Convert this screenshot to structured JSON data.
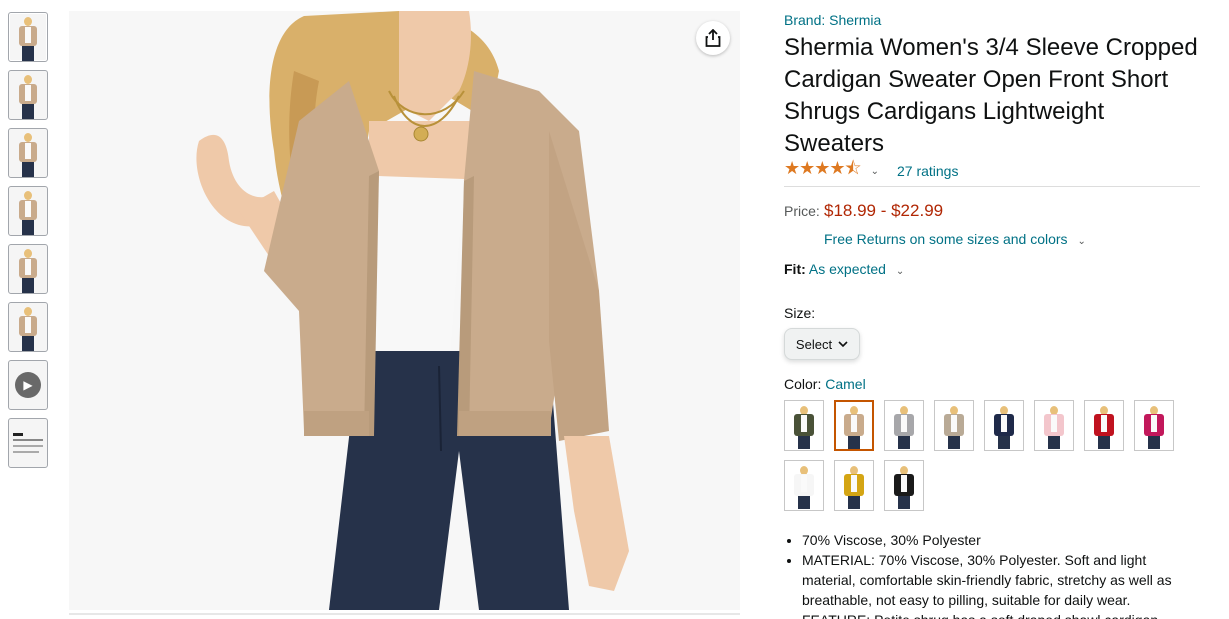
{
  "thumbnails": [
    {
      "type": "image",
      "selected": true
    },
    {
      "type": "image"
    },
    {
      "type": "image"
    },
    {
      "type": "image"
    },
    {
      "type": "image"
    },
    {
      "type": "image"
    },
    {
      "type": "video"
    },
    {
      "type": "image"
    }
  ],
  "share_icon": "share-icon",
  "product": {
    "brand": "Brand: Shermia",
    "title": "Shermia Women's 3/4 Sleeve Cropped Cardigan Sweater Open Front Short Shrugs Cardigans Lightweight Sweaters",
    "rating_stars": "★★★★⯪",
    "rating_value": 4.5,
    "ratings_count": "27 ratings",
    "price_label": "Price:",
    "price_range": "$18.99 - $22.99",
    "free_returns": "Free Returns on some sizes and colors",
    "fit_label": "Fit:",
    "fit_value": "As expected",
    "size_label": "Size:",
    "size_select": "Select",
    "color_label": "Color:",
    "color_value": "Camel",
    "colors": [
      {
        "name": "Army Green",
        "hex": "#4a5238"
      },
      {
        "name": "Camel",
        "hex": "#c9ab8c",
        "selected": true
      },
      {
        "name": "Grey",
        "hex": "#a7a7aa"
      },
      {
        "name": "Khaki",
        "hex": "#b9aa96"
      },
      {
        "name": "Navy",
        "hex": "#1f2a4a"
      },
      {
        "name": "Pink",
        "hex": "#f3c6cc"
      },
      {
        "name": "Red",
        "hex": "#c0121f"
      },
      {
        "name": "Rose",
        "hex": "#c2185b"
      },
      {
        "name": "White",
        "hex": "#f6f6f6"
      },
      {
        "name": "Yellow",
        "hex": "#d4a514"
      },
      {
        "name": "Black",
        "hex": "#1a1a1a"
      }
    ],
    "bullets": [
      "70% Viscose, 30% Polyester",
      "MATERIAL: 70% Viscose, 30% Polyester. Soft and light material, comfortable skin-friendly fabric, stretchy as well as breathable, not easy to pilling, suitable for daily wear.",
      "FEATURE: Petite shrug has a soft draped shawl cardigan"
    ]
  },
  "colors": {
    "link": "#007185",
    "price": "#b12704",
    "star": "#de7921",
    "selected_border": "#c45500"
  }
}
